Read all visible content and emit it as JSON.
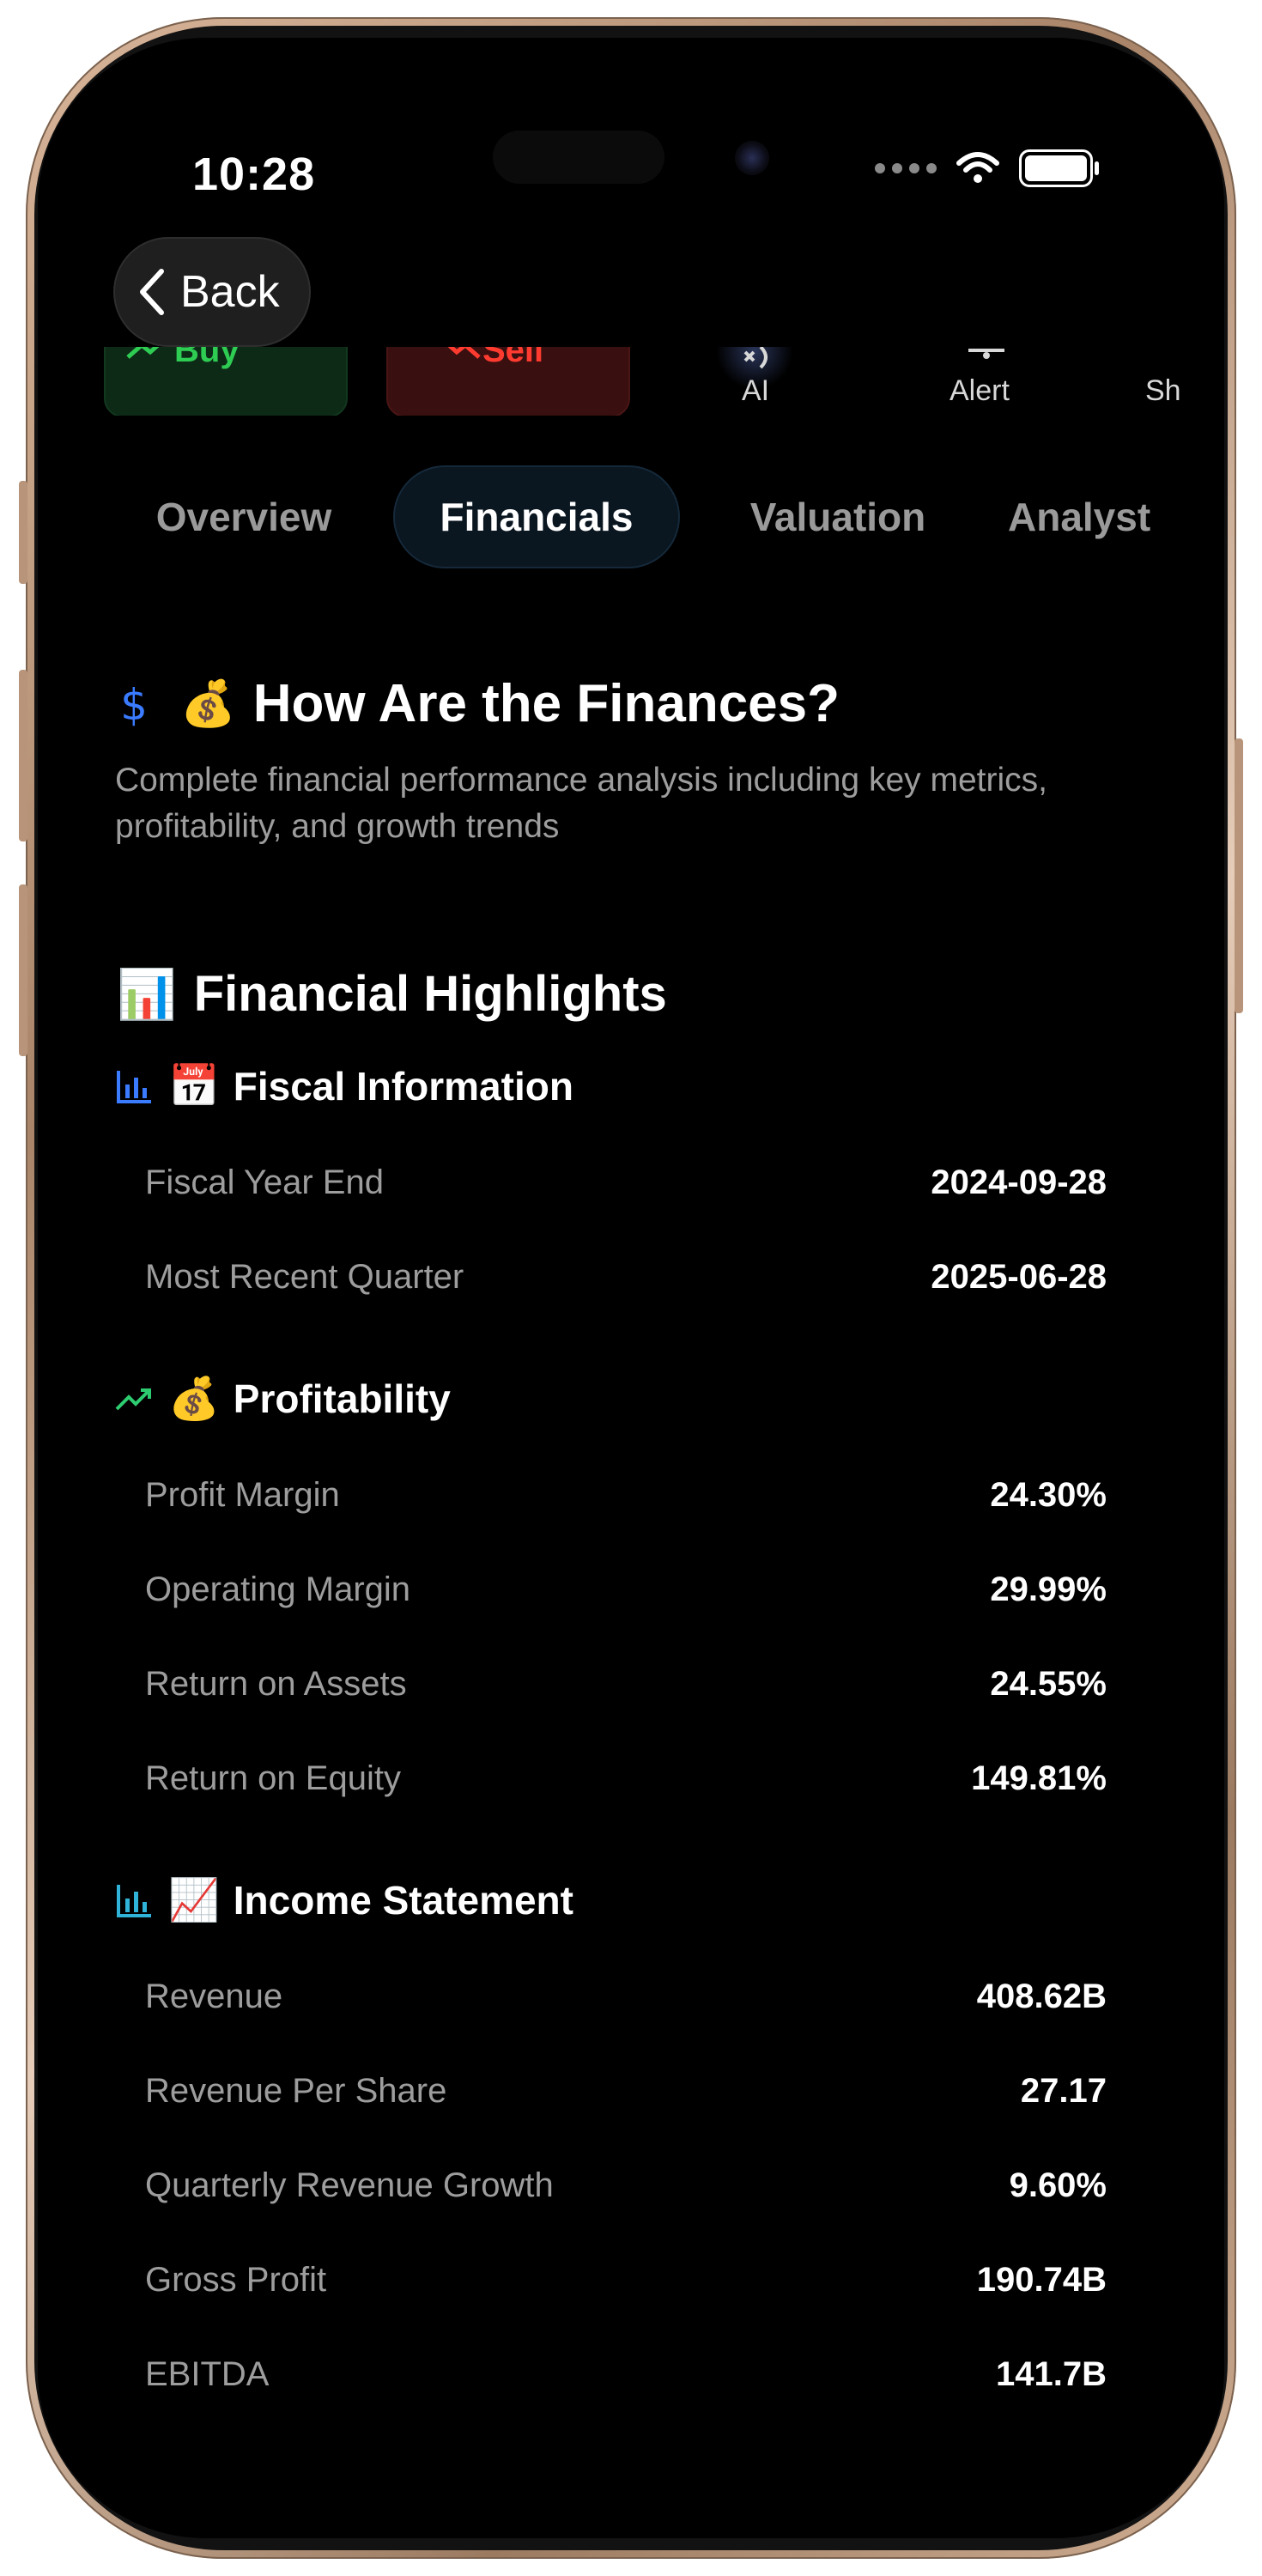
{
  "status_bar": {
    "time": "10:28"
  },
  "nav": {
    "back_label": "Back"
  },
  "actions": {
    "buy_label": "Buy",
    "sell_label": "Sell",
    "ai_label": "AI",
    "alert_label": "Alert",
    "share_label": "Sh"
  },
  "tabs": [
    {
      "label": "Overview",
      "active": false
    },
    {
      "label": "Financials",
      "active": true
    },
    {
      "label": "Valuation",
      "active": false
    },
    {
      "label": "Analyst",
      "active": false
    }
  ],
  "hero": {
    "icon": "dollar-icon",
    "emoji": "💰",
    "title": "How Are the Finances?",
    "description": "Complete financial performance analysis including key metrics, profitability, and growth trends"
  },
  "highlights": {
    "emoji": "📊",
    "title": "Financial Highlights",
    "groups": [
      {
        "icon": "bar-chart-icon",
        "emoji": "📅",
        "title": "Fiscal Information",
        "rows": [
          {
            "label": "Fiscal Year End",
            "value": "2024-09-28"
          },
          {
            "label": "Most Recent Quarter",
            "value": "2025-06-28"
          }
        ]
      },
      {
        "icon": "trending-up-icon",
        "emoji": "💰",
        "title": "Profitability",
        "rows": [
          {
            "label": "Profit Margin",
            "value": "24.30%"
          },
          {
            "label": "Operating Margin",
            "value": "29.99%"
          },
          {
            "label": "Return on Assets",
            "value": "24.55%"
          },
          {
            "label": "Return on Equity",
            "value": "149.81%"
          }
        ]
      },
      {
        "icon": "bar-chart-icon",
        "emoji": "📈",
        "title": "Income Statement",
        "rows": [
          {
            "label": "Revenue",
            "value": "408.62B"
          },
          {
            "label": "Revenue Per Share",
            "value": "27.17"
          },
          {
            "label": "Quarterly Revenue Growth",
            "value": "9.60%"
          },
          {
            "label": "Gross Profit",
            "value": "190.74B"
          },
          {
            "label": "EBITDA",
            "value": "141.7B"
          }
        ]
      }
    ]
  },
  "colors": {
    "background": "#000000",
    "accent_blue": "#3a7bff",
    "accent_green": "#2ecc71",
    "buy_green": "#2ecc52",
    "sell_red": "#ff3b30",
    "muted_text": "#9d9d9d"
  }
}
